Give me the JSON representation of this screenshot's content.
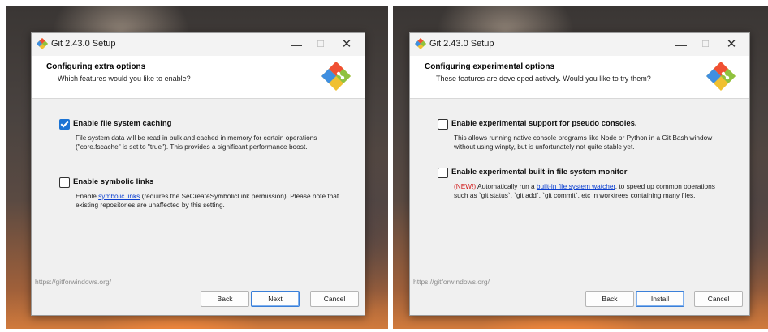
{
  "window": {
    "title": "Git 2.43.0 Setup",
    "minimize_glyph": "—",
    "maximize_glyph": "☐",
    "close_glyph": "✕"
  },
  "left_dialog": {
    "header_title": "Configuring extra options",
    "header_subtitle": "Which features would you like to enable?",
    "options": [
      {
        "label": "Enable file system caching",
        "checked": true,
        "desc": "File system data will be read in bulk and cached in memory for certain operations (\"core.fscache\" is set to \"true\"). This provides a significant performance boost."
      },
      {
        "label": "Enable symbolic links",
        "checked": false,
        "desc_pre": "Enable ",
        "desc_link": "symbolic links",
        "desc_post": " (requires the SeCreateSymbolicLink permission). Please note that existing repositories are unaffected by this setting."
      }
    ],
    "footer_url": "https://gitforwindows.org/",
    "buttons": {
      "back": "Back",
      "next": "Next",
      "cancel": "Cancel"
    }
  },
  "right_dialog": {
    "header_title": "Configuring experimental options",
    "header_subtitle": "These features are developed actively. Would you like to try them?",
    "options": [
      {
        "label": "Enable experimental support for pseudo consoles.",
        "checked": false,
        "desc": "This allows running native console programs like Node or Python in a Git Bash window without using winpty, but is unfortunately not quite stable yet."
      },
      {
        "label": "Enable experimental built-in file system monitor",
        "checked": false,
        "desc_new": "(NEW!)",
        "desc_pre": " Automatically run a ",
        "desc_link": "built-in file system watcher",
        "desc_post": ", to speed up common operations such as `git status`, `git add`, `git commit`, etc in worktrees containing many files."
      }
    ],
    "footer_url": "https://gitforwindows.org/",
    "buttons": {
      "back": "Back",
      "install": "Install",
      "cancel": "Cancel"
    }
  },
  "colors": {
    "accent": "#1a73d4",
    "link": "#0b3fd0",
    "new_tag": "#d11a1a",
    "git_orange": "#f05033",
    "git_green": "#8fc23f",
    "git_blue": "#3f8fe0",
    "git_yellow": "#f0c030"
  }
}
